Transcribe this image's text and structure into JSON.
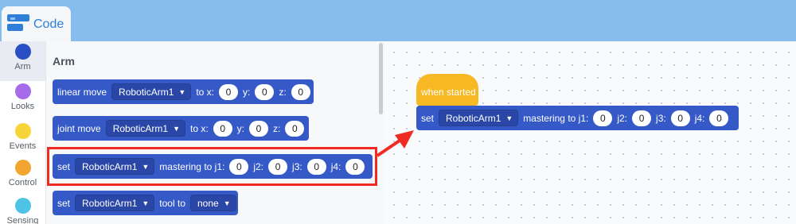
{
  "tabs": {
    "code_label": "Code"
  },
  "categories": [
    {
      "label": "Arm",
      "color": "#2a4ec4"
    },
    {
      "label": "Looks",
      "color": "#a56bea"
    },
    {
      "label": "Events",
      "color": "#f7d43a"
    },
    {
      "label": "Control",
      "color": "#f2a630"
    },
    {
      "label": "Sensing",
      "color": "#4ec3e6"
    }
  ],
  "flyout": {
    "title": "Arm",
    "linear_move": {
      "label": "linear move",
      "arm": "RoboticArm1",
      "to_x": "to x:",
      "x": "0",
      "y_label": "y:",
      "y": "0",
      "z_label": "z:",
      "z": "0"
    },
    "joint_move": {
      "label": "joint move",
      "arm": "RoboticArm1",
      "to_x": "to x:",
      "x": "0",
      "y_label": "y:",
      "y": "0",
      "z_label": "z:",
      "z": "0"
    },
    "set_mastering": {
      "label": "set",
      "arm": "RoboticArm1",
      "mastering": "mastering to j1:",
      "j1": "0",
      "j2_label": "j2:",
      "j2": "0",
      "j3_label": "j3:",
      "j3": "0",
      "j4_label": "j4:",
      "j4": "0"
    },
    "set_tool": {
      "label": "set",
      "arm": "RoboticArm1",
      "tool_to": "tool to",
      "tool": "none"
    }
  },
  "workspace": {
    "hat_label": "when started",
    "set_mastering": {
      "label": "set",
      "arm": "RoboticArm1",
      "mastering": "mastering to j1:",
      "j1": "0",
      "j2_label": "j2:",
      "j2": "0",
      "j3_label": "j3:",
      "j3": "0",
      "j4_label": "j4:",
      "j4": "0"
    }
  },
  "colors": {
    "block": "#3559c7",
    "hat": "#f6b924",
    "highlight": "#ef2b24",
    "topbar": "#85bdee"
  }
}
